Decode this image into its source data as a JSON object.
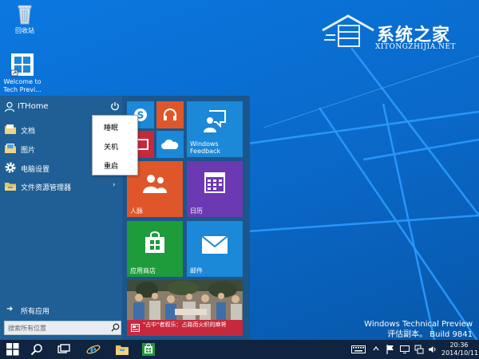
{
  "desktop": {
    "icons": [
      {
        "label": "回收站"
      },
      {
        "label": "Welcome to Tech Previ..."
      }
    ]
  },
  "watermark": {
    "title": "系统之家",
    "url": "XITONGZHIJIA.NET"
  },
  "build_info": {
    "line1": "Windows Technical Preview",
    "line2": "评估副本。 Build 9841"
  },
  "start_menu": {
    "user_name": "ITHome",
    "items": [
      {
        "label": "文档",
        "icon": "folder-icon"
      },
      {
        "label": "图片",
        "icon": "pictures-icon"
      },
      {
        "label": "电脑设置",
        "icon": "gear-icon"
      },
      {
        "label": "文件资源管理器",
        "icon": "explorer-icon",
        "chevron": "›"
      }
    ],
    "all_apps": "所有应用",
    "search_placeholder": "搜索所有位置"
  },
  "power_menu": {
    "items": [
      {
        "label": "睡眠"
      },
      {
        "label": "关机"
      },
      {
        "label": "重启"
      }
    ]
  },
  "tiles": {
    "windows_feedback": "Windows Feedback",
    "people": "人脉",
    "calendar": "日历",
    "store": "应用商店",
    "mail": "邮件",
    "news_headline": "\"占中\"者叙乐：占路而火织的麻将"
  },
  "taskbar": {
    "time": "20:36",
    "date": "2014/10/11"
  },
  "colors": {
    "start_left": "#1f5f95",
    "tile_blue": "#1b88d8",
    "tile_orange": "#e0562b",
    "tile_purple": "#6b3ab2",
    "tile_green": "#1e9b3a",
    "tile_red": "#c8283c",
    "taskbar": "#10233f"
  }
}
